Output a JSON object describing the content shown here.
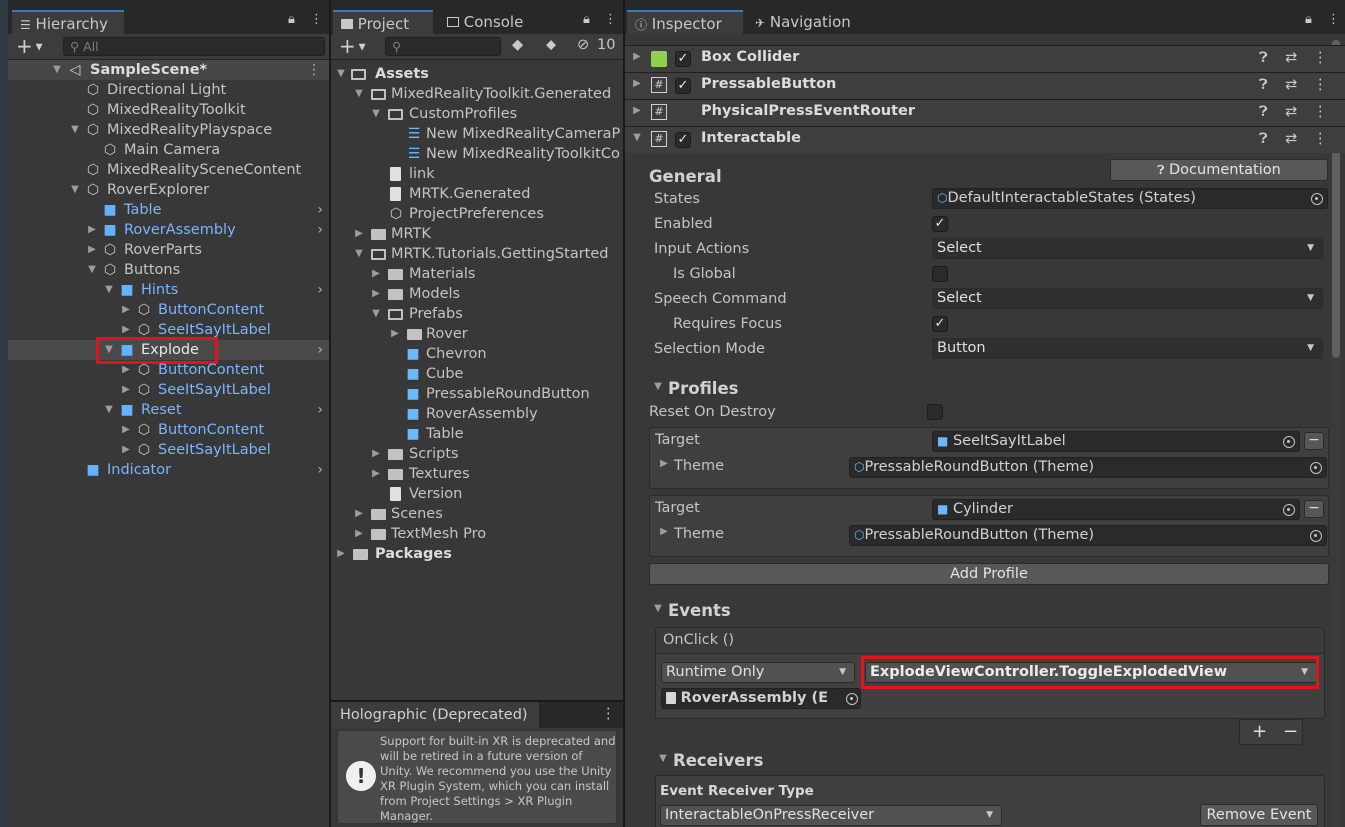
{
  "hierarchy": {
    "tab_label": "Hierarchy",
    "search_placeholder": "All",
    "items": [
      {
        "label": "SampleScene*",
        "depth": 0
      },
      {
        "label": "Directional Light"
      },
      {
        "label": "MixedRealityToolkit"
      },
      {
        "label": "MixedRealityPlayspace"
      },
      {
        "label": "Main Camera"
      },
      {
        "label": "MixedRealitySceneContent"
      },
      {
        "label": "RoverExplorer"
      },
      {
        "label": "Table"
      },
      {
        "label": "RoverAssembly"
      },
      {
        "label": "RoverParts"
      },
      {
        "label": "Buttons"
      },
      {
        "label": "Hints"
      },
      {
        "label": "ButtonContent"
      },
      {
        "label": "SeeItSayItLabel"
      },
      {
        "label": "Explode"
      },
      {
        "label": "ButtonContent"
      },
      {
        "label": "SeeItSayItLabel"
      },
      {
        "label": "Reset"
      },
      {
        "label": "ButtonContent"
      },
      {
        "label": "SeeItSayItLabel"
      },
      {
        "label": "Indicator"
      }
    ]
  },
  "project": {
    "tab_project": "Project",
    "tab_console": "Console",
    "hidden_count": "10",
    "items": [
      {
        "label": "Assets"
      },
      {
        "label": "MixedRealityToolkit.Generated"
      },
      {
        "label": "CustomProfiles"
      },
      {
        "label": "New MixedRealityCameraP"
      },
      {
        "label": "New MixedRealityToolkitCo"
      },
      {
        "label": "link"
      },
      {
        "label": "MRTK.Generated"
      },
      {
        "label": "ProjectPreferences"
      },
      {
        "label": "MRTK"
      },
      {
        "label": "MRTK.Tutorials.GettingStarted"
      },
      {
        "label": "Materials"
      },
      {
        "label": "Models"
      },
      {
        "label": "Prefabs"
      },
      {
        "label": "Rover"
      },
      {
        "label": "Chevron"
      },
      {
        "label": "Cube"
      },
      {
        "label": "PressableRoundButton"
      },
      {
        "label": "RoverAssembly"
      },
      {
        "label": "Table"
      },
      {
        "label": "Scripts"
      },
      {
        "label": "Textures"
      },
      {
        "label": "Version"
      },
      {
        "label": "Scenes"
      },
      {
        "label": "TextMesh Pro"
      },
      {
        "label": "Packages"
      }
    ]
  },
  "holographic": {
    "title": "Holographic (Deprecated)",
    "message": "Support for built-in XR is deprecated and will be retired in a future version of Unity. We recommend you use the Unity XR Plugin System, which you can install from Project Settings > XR Plugin Manager."
  },
  "inspector": {
    "tab_inspector": "Inspector",
    "tab_navigation": "Navigation",
    "components": {
      "box_collider": "Box Collider",
      "pressable_button": "PressableButton",
      "physical_press": "PhysicalPressEventRouter",
      "interactable": "Interactable"
    },
    "documentation_button": "Documentation",
    "general": {
      "title": "General",
      "states_label": "States",
      "states_value": "DefaultInteractableStates (States)",
      "enabled_label": "Enabled",
      "input_actions_label": "Input Actions",
      "input_actions_value": "Select",
      "is_global_label": "Is Global",
      "speech_command_label": "Speech Command",
      "speech_command_value": "Select",
      "requires_focus_label": "Requires Focus",
      "selection_mode_label": "Selection Mode",
      "selection_mode_value": "Button"
    },
    "profiles": {
      "title": "Profiles",
      "reset_on_destroy_label": "Reset On Destroy",
      "target_label": "Target",
      "theme_label": "Theme",
      "profile1_target": "SeeItSayItLabel",
      "profile1_theme": "PressableRoundButton (Theme)",
      "profile2_target": "Cylinder",
      "profile2_theme": "PressableRoundButton (Theme)",
      "add_profile_button": "Add Profile"
    },
    "events": {
      "title": "Events",
      "onclick_label": "OnClick ()",
      "runtime_value": "Runtime Only",
      "function_value": "ExplodeViewController.ToggleExplodedView",
      "object_value": "RoverAssembly (E",
      "plus": "+",
      "minus": "−"
    },
    "receivers": {
      "title": "Receivers",
      "type_label": "Event Receiver Type",
      "type_value": "InteractableOnPressReceiver",
      "remove_event_button": "Remove Event"
    }
  },
  "colors": {
    "highlight": "#e3121b",
    "prefab_blue": "#61b3ff",
    "panel_bg": "#383838"
  }
}
